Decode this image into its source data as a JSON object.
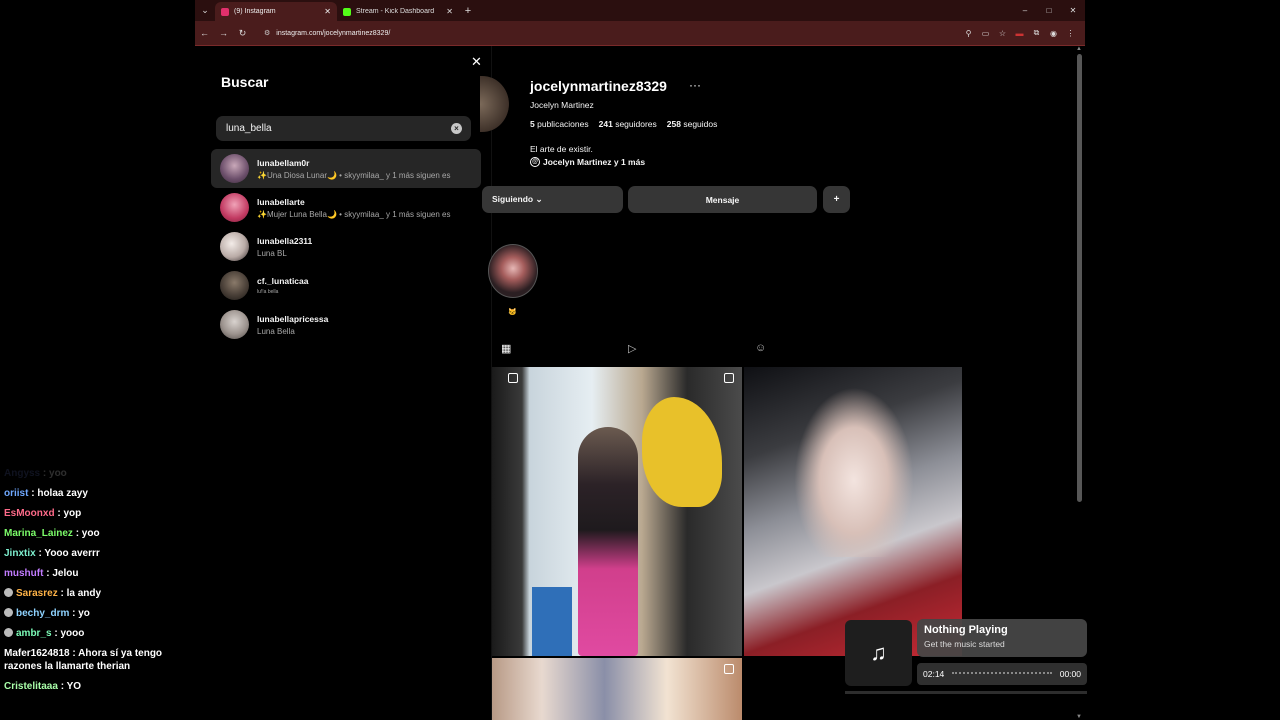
{
  "browser": {
    "tabs": [
      {
        "title": "(9) Instagram",
        "favicon_color": "#e1306c",
        "active": true
      },
      {
        "title": "Stream - Kick Dashboard",
        "favicon_color": "#53fc18",
        "active": false
      }
    ],
    "url": "instagram.com/jocelynmartinez8329/",
    "controls": {
      "back": "←",
      "forward": "→",
      "reload": "↻",
      "new_tab": "+",
      "minimize": "–",
      "maximize": "□",
      "close": "✕"
    }
  },
  "search": {
    "title": "Buscar",
    "query": "luna_bella",
    "results": [
      {
        "username": "lunabellam0r",
        "subtitle": "✨Una Diosa Lunar🌙 • skyymilaa_ y 1 más siguen es",
        "avatar_color": "#8a6a8a"
      },
      {
        "username": "lunabellarte",
        "subtitle": "✨Mujer Luna Bella🌙 • skyymilaa_ y 1 más siguen es",
        "avatar_color": "#d04a70"
      },
      {
        "username": "lunabella2311",
        "subtitle": "Luna BL",
        "avatar_color": "#e6ddd8"
      },
      {
        "username": "cf._lunaticaa",
        "subtitle": "lu!!a bella",
        "avatar_color": "#4a4038"
      },
      {
        "username": "lunabellapricessa",
        "subtitle": "Luna Bella",
        "avatar_color": "#b9b1ad"
      }
    ]
  },
  "profile": {
    "username": "jocelynmartinez8329",
    "more": "···",
    "full_name": "Jocelyn Martinez",
    "stats": {
      "posts_count": "5",
      "posts_label": "publicaciones",
      "followers_count": "241",
      "followers_label": "seguidores",
      "following_count": "258",
      "following_label": "seguidos"
    },
    "bio": "El arte de existir.",
    "threads_text": "Jocelyn Martinez y 1 más",
    "buttons": {
      "following": "Siguiendo ⌄",
      "message": "Mensaje",
      "add_user": "+"
    },
    "highlight_label": "🐱",
    "tabs": {
      "posts": "▦",
      "reels": "▷",
      "tagged": "☺"
    }
  },
  "chat": [
    {
      "user": "Angyss",
      "message": ": yoo",
      "color": "#5566aa",
      "faded": true
    },
    {
      "user": "oriist",
      "message": ": holaa zayy",
      "color": "#6fa8ff"
    },
    {
      "user": "EsMoonxd",
      "message": ": yop",
      "color": "#ff6b8a"
    },
    {
      "user": "Marina_Lainez",
      "message": ": yoo",
      "color": "#7cfc6a"
    },
    {
      "user": "Jinxtix",
      "message": ": Yooo averrr",
      "color": "#7ff0d0"
    },
    {
      "user": "mushuft",
      "message": ": Jelou",
      "color": "#c27cff"
    },
    {
      "user": "Sarasrez",
      "message": ": la andy",
      "color": "#ffb347",
      "badge": true
    },
    {
      "user": "bechy_drm",
      "message": ": yo",
      "color": "#8fd3ff",
      "badge": true
    },
    {
      "user": "ambr_s",
      "message": ": yooo",
      "color": "#7cfcb8",
      "badge": true
    },
    {
      "user": "Mafer1624818",
      "message": ": Ahora sí ya tengo razones la llamarte therian",
      "color": "#ffffff"
    },
    {
      "user": "Cristelitaaa",
      "message": ": YO",
      "color": "#aaffaa"
    }
  ],
  "music": {
    "icon": "♫",
    "title": "Nothing Playing",
    "subtitle": "Get the music started",
    "elapsed": "02:14",
    "remaining": "00:00"
  }
}
